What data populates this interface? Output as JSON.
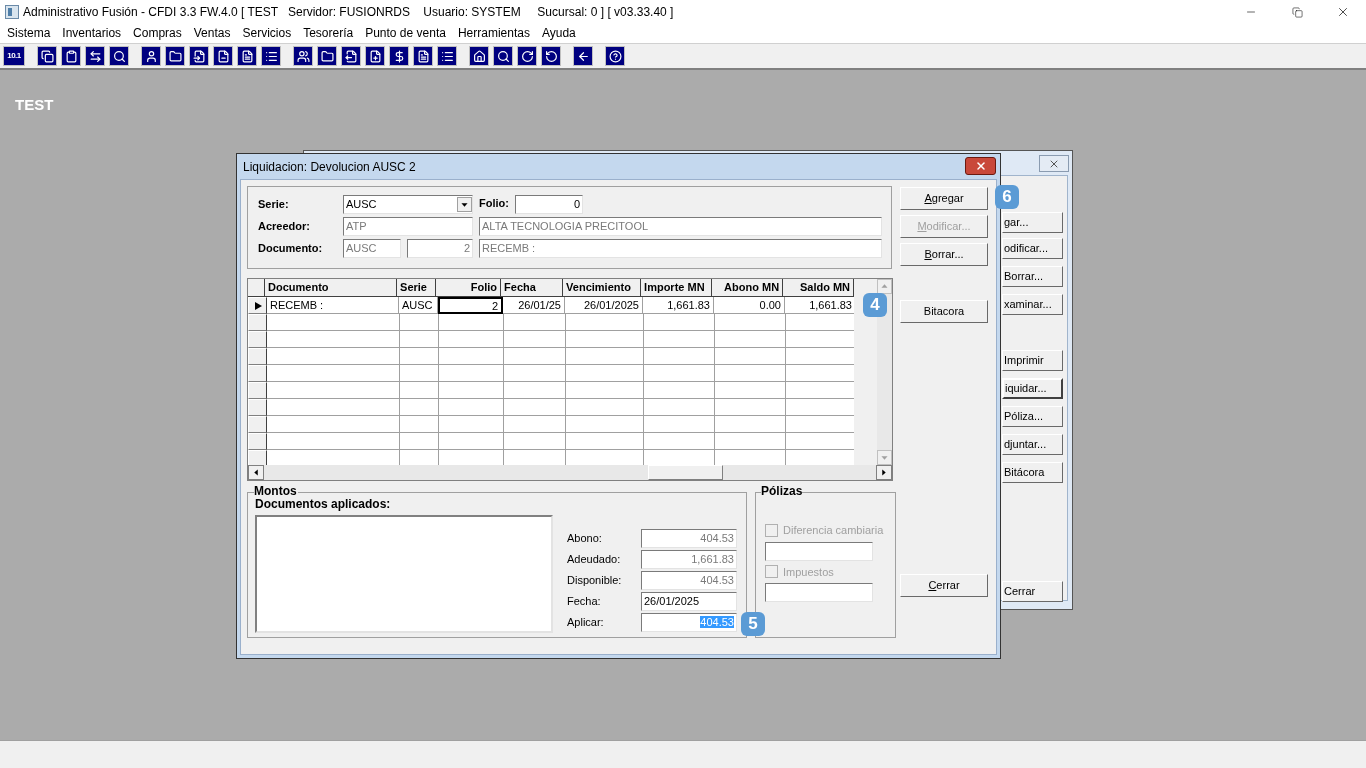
{
  "window": {
    "title": "Administrativo Fusión - CFDI 3.3 FW.4.0 [ TEST   Servidor: FUSIONRDS    Usuario: SYSTEM     Sucursal: 0 ] [ v03.33.40 ]"
  },
  "menu": [
    "Sistema",
    "Inventarios",
    "Compras",
    "Ventas",
    "Servicios",
    "Tesorería",
    "Punto de venta",
    "Herramientas",
    "Ayuda"
  ],
  "toolbar": {
    "first_button_label": "10.1"
  },
  "workspace_label": "TEST",
  "back_window": {
    "buttons": [
      {
        "label": "gar...",
        "default": false
      },
      {
        "label": "odificar...",
        "default": false
      },
      {
        "label": "Borrar...",
        "default": false
      },
      {
        "label": "xaminar...",
        "default": false
      },
      {
        "label": "Imprimir",
        "default": false
      },
      {
        "label": "iquidar...",
        "default": true
      },
      {
        "label": "Póliza...",
        "default": false
      },
      {
        "label": "djuntar...",
        "default": false
      },
      {
        "label": "Bitácora",
        "default": false
      },
      {
        "label": "Cerrar",
        "default": false
      }
    ]
  },
  "dialog": {
    "title": "Liquidacion: Devolucion AUSC 2",
    "header": {
      "serie": {
        "label": "Serie:",
        "value": "AUSC"
      },
      "folio": {
        "label": "Folio:",
        "value": "0"
      },
      "acreedor": {
        "label": "Acreedor:",
        "code": "ATP",
        "name": "ALTA TECNOLOGIA PRECITOOL",
        "disabled": true
      },
      "documento": {
        "label": "Documento:",
        "serie": "AUSC",
        "folio": "2",
        "concept": "RECEMB :",
        "disabled": true
      }
    },
    "grid": {
      "columns": [
        {
          "label": "Documento"
        },
        {
          "label": "Serie"
        },
        {
          "label": "Folio"
        },
        {
          "label": "Fecha"
        },
        {
          "label": "Vencimiento"
        },
        {
          "label": "Importe MN"
        },
        {
          "label": "Abono MN"
        },
        {
          "label": "Saldo MN"
        }
      ],
      "rows": [
        {
          "selected": true,
          "cells": [
            {
              "text": "RECEMB :",
              "focused": false
            },
            {
              "text": "AUSC",
              "focused": false
            },
            {
              "text": "2",
              "focused": true
            },
            {
              "text": "26/01/25",
              "focused": false
            },
            {
              "text": "26/01/2025",
              "focused": false
            },
            {
              "text": "1,661.83",
              "focused": false
            },
            {
              "text": "0.00",
              "focused": false
            },
            {
              "text": "1,661.83",
              "focused": false
            }
          ]
        }
      ]
    },
    "buttons": [
      {
        "label": "Agregar",
        "disabled": false,
        "access_key": true
      },
      {
        "label": "Modificar...",
        "disabled": true,
        "access_key": true
      },
      {
        "label": "Borrar...",
        "disabled": false,
        "access_key": true
      },
      {
        "label": "Bitacora",
        "disabled": false,
        "access_key": false
      }
    ],
    "close_button": {
      "label": "Cerrar",
      "access_key": true
    },
    "montos": {
      "title": "Montos",
      "list_label": "Documentos aplicados:",
      "fields": [
        {
          "label": "Abono:",
          "value": "404.53",
          "disabled": true,
          "text_selected": false
        },
        {
          "label": "Adeudado:",
          "value": "1,661.83",
          "disabled": true,
          "text_selected": false
        },
        {
          "label": "Disponible:",
          "value": "404.53",
          "disabled": true,
          "text_selected": false
        },
        {
          "label": "Fecha:",
          "value": "26/01/2025",
          "disabled": false,
          "text_selected": false
        },
        {
          "label": "Aplicar:",
          "value": "404.53",
          "disabled": false,
          "text_selected": true
        }
      ]
    },
    "polizas": {
      "title": "Pólizas",
      "options": [
        {
          "label": "Diferencia cambiaria",
          "checked": false,
          "disabled": true
        },
        {
          "label": "Impuestos",
          "checked": false,
          "disabled": true
        }
      ]
    }
  },
  "annotations": [
    {
      "label": "6"
    },
    {
      "label": "4"
    },
    {
      "label": "5"
    }
  ]
}
